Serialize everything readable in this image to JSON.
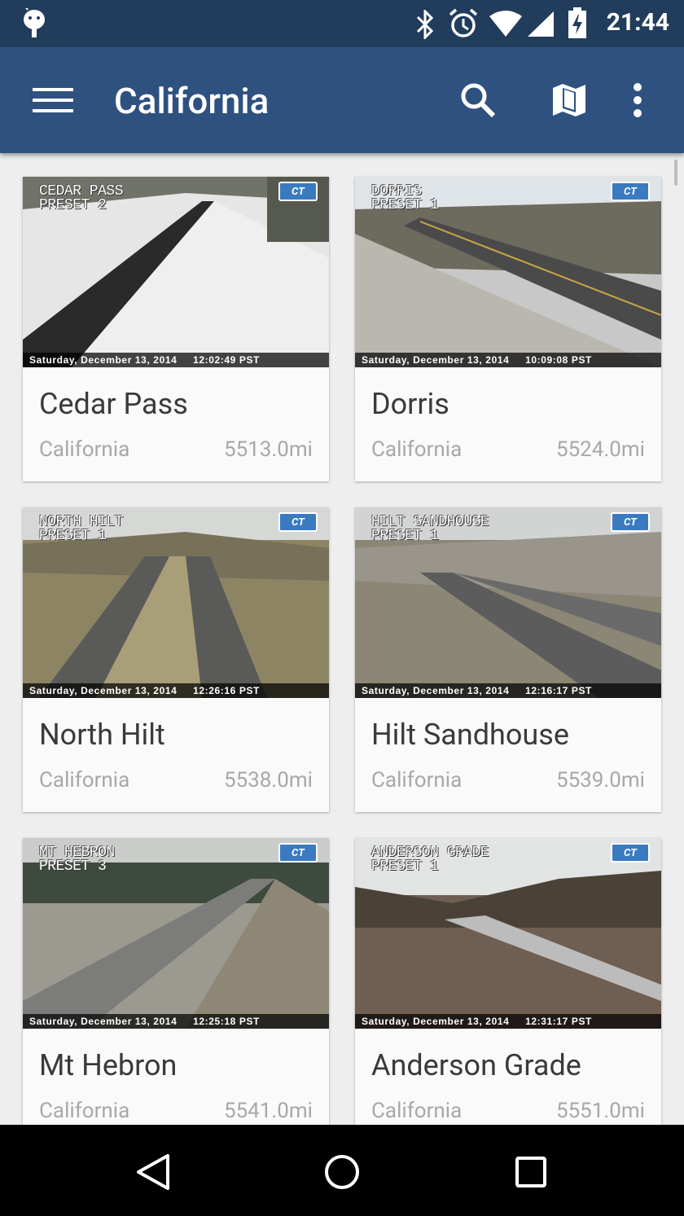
{
  "status_bar": {
    "time": "21:44"
  },
  "toolbar": {
    "title": "California"
  },
  "cards": [
    {
      "name": "Cedar Pass",
      "region": "California",
      "distance": "5513.0mi",
      "cam_label": "CEDAR PASS\nPRESET 2",
      "timestamp": "Saturday, December 13, 2014     12:02:49 PST"
    },
    {
      "name": "Dorris",
      "region": "California",
      "distance": "5524.0mi",
      "cam_label": "DORRIS\nPRESET 1",
      "timestamp": "Saturday, December 13, 2014     10:09:08 PST"
    },
    {
      "name": "North Hilt",
      "region": "California",
      "distance": "5538.0mi",
      "cam_label": "NORTH HILT\nPRESET 1",
      "timestamp": "Saturday, December 13, 2014     12:26:16 PST"
    },
    {
      "name": "Hilt Sandhouse",
      "region": "California",
      "distance": "5539.0mi",
      "cam_label": "HILT SANDHOUSE\nPRESET 1",
      "timestamp": "Saturday, December 13, 2014     12:16:17 PST"
    },
    {
      "name": "Mt Hebron",
      "region": "California",
      "distance": "5541.0mi",
      "cam_label": "MT HEBRON\nPRESET 3",
      "timestamp": "Saturday, December 13, 2014     12:25:18 PST"
    },
    {
      "name": "Anderson Grade",
      "region": "California",
      "distance": "5551.0mi",
      "cam_label": "ANDERSON GRADE\nPRESET 1",
      "timestamp": "Saturday, December 13, 2014     12:31:17 PST"
    }
  ],
  "icons": {
    "status": [
      "android-debug-icon",
      "bluetooth-icon",
      "alarm-icon",
      "wifi-icon",
      "signal-icon",
      "battery-charging-icon"
    ],
    "toolbar": [
      "menu-icon",
      "search-icon",
      "map-icon",
      "more-vert-icon"
    ],
    "nav": [
      "back-icon",
      "home-icon",
      "recents-icon"
    ]
  },
  "colors": {
    "status_bar": "#223c5c",
    "app_bar": "#2f5180",
    "background": "#eeeeee",
    "card": "#fafafa"
  }
}
